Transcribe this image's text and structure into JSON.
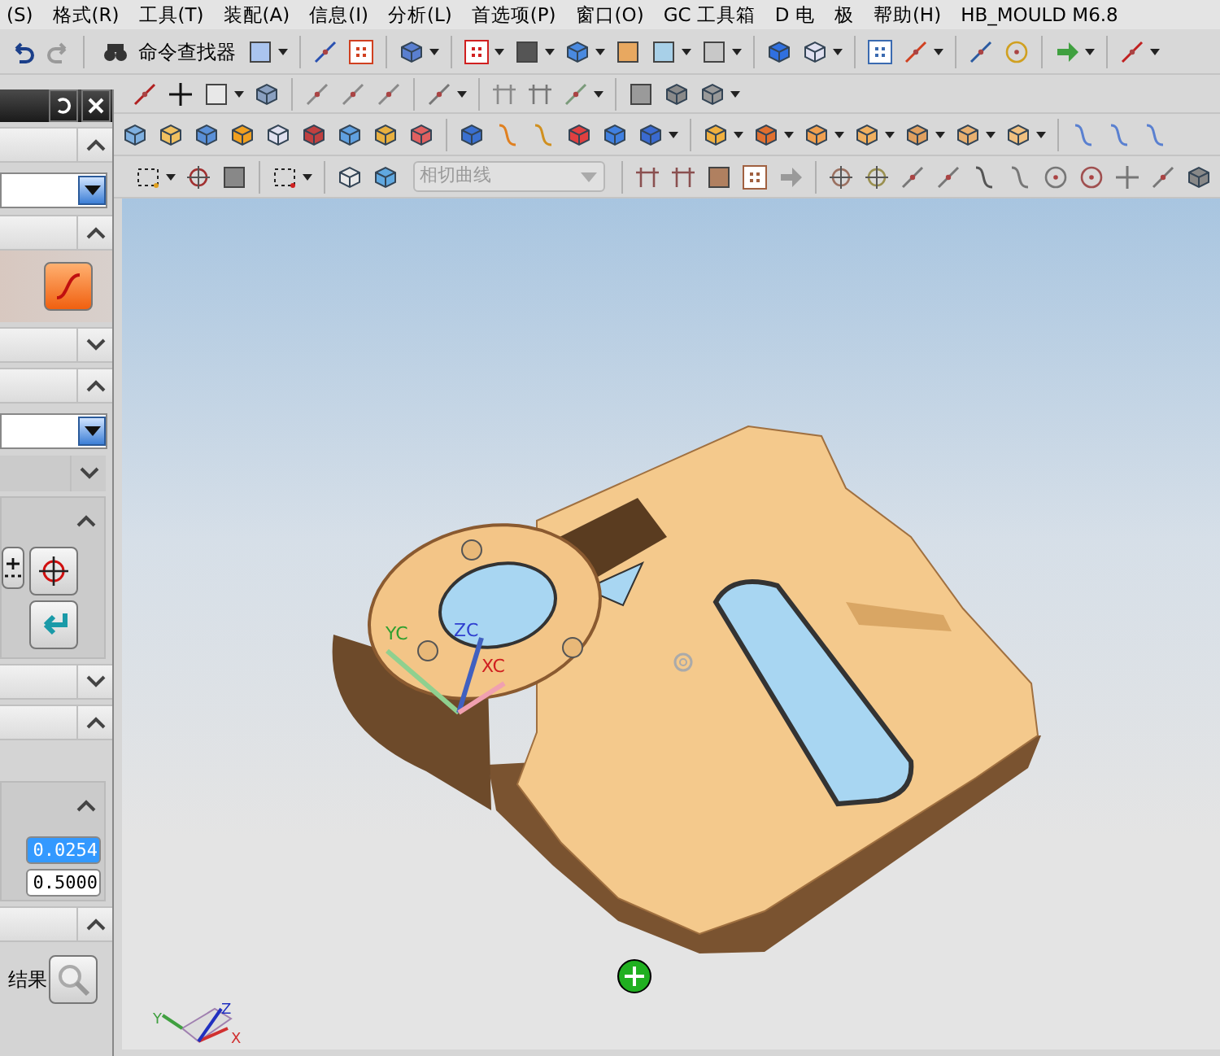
{
  "menu_bar": [
    {
      "label": "(S)"
    },
    {
      "label": "格式(R)"
    },
    {
      "label": "工具(T)"
    },
    {
      "label": "装配(A)"
    },
    {
      "label": "信息(I)"
    },
    {
      "label": "分析(L)"
    },
    {
      "label": "首选项(P)"
    },
    {
      "label": "窗口(O)"
    },
    {
      "label": "GC 工具箱"
    },
    {
      "label": "D 电　极"
    },
    {
      "label": "帮助(H)"
    },
    {
      "label": "HB_MOULD M6.8"
    }
  ],
  "toolbar": {
    "command_finder": "命令查找器",
    "curve_rule": {
      "value": "相切曲线",
      "disabled": true
    }
  },
  "panel": {
    "items": [
      {
        "kind": "header",
        "expanded": true
      },
      {
        "kind": "dropdown"
      },
      {
        "kind": "header",
        "expanded": true
      },
      {
        "kind": "curve_button"
      },
      {
        "kind": "header",
        "expanded": false
      },
      {
        "kind": "header",
        "expanded": true
      },
      {
        "kind": "dropdown"
      },
      {
        "kind": "subheader",
        "expanded": false
      },
      {
        "kind": "point_group",
        "expanded": true
      },
      {
        "kind": "header",
        "expanded": false
      },
      {
        "kind": "header",
        "expanded": true
      },
      {
        "kind": "value_group",
        "expanded": true,
        "fields": [
          {
            "value": "0.0254",
            "selected": true
          },
          {
            "value": "0.5000",
            "selected": false
          }
        ]
      },
      {
        "kind": "header",
        "expanded": true
      },
      {
        "kind": "result_row",
        "label": "结果"
      }
    ]
  },
  "viewport": {
    "wcs_labels": [
      "YC",
      "ZC",
      "XC"
    ],
    "view_triad_labels": [
      "Y",
      "Z",
      "X"
    ]
  }
}
